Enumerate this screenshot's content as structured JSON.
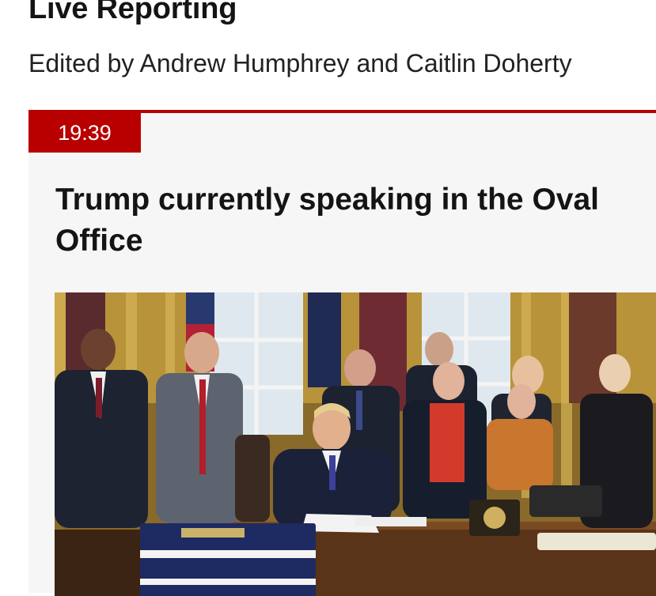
{
  "page": {
    "title": "Live Reporting",
    "byline": "Edited by Andrew Humphrey and Caitlin Doherty"
  },
  "post": {
    "time": "19:39",
    "headline": "Trump currently speaking in the Oval Office",
    "image_alt": "Photo of Trump seated at the Resolute desk in the Oval Office surrounded by standing officials"
  },
  "colors": {
    "accent": "#b80000",
    "card_background": "#f6f6f6"
  }
}
